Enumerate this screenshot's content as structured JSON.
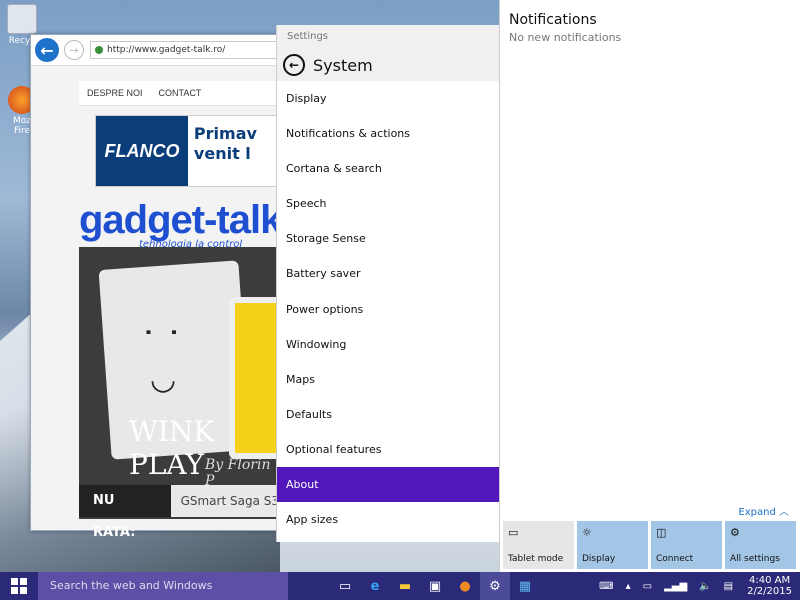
{
  "desktop": {
    "icons": [
      {
        "label": "Recyc",
        "icon": "recycle-bin-icon"
      },
      {
        "label": "Moz Fire",
        "icon": "firefox-icon"
      }
    ]
  },
  "browser": {
    "url": "http://www.gadget-talk.ro/",
    "menu": [
      "DESPRE NOI",
      "CONTACT"
    ],
    "ad": {
      "brand": "FLANCO",
      "text": "Primav venit l"
    },
    "logo": {
      "name": "gadget-talk",
      "tagline": "tehnologia la control"
    },
    "hero": {
      "title": "WINK PLAY",
      "author": "By Florin P"
    },
    "ticker": {
      "label": "NU RATA:",
      "text": "GSmart Saga S3"
    }
  },
  "settings": {
    "window_title": "Settings",
    "page_title": "System",
    "items": [
      "Display",
      "Notifications & actions",
      "Cortana & search",
      "Speech",
      "Storage Sense",
      "Battery saver",
      "Power options",
      "Windowing",
      "Maps",
      "Defaults",
      "Optional features",
      "About",
      "App sizes"
    ],
    "active_index": 11
  },
  "notifications": {
    "title": "Notifications",
    "subtitle": "No new notifications",
    "expand": "Expand",
    "tiles": [
      {
        "label": "Tablet mode",
        "icon": "tablet-icon",
        "on": false
      },
      {
        "label": "Display",
        "icon": "sun-icon",
        "on": true
      },
      {
        "label": "Connect",
        "icon": "connect-icon",
        "on": true
      },
      {
        "label": "All settings",
        "icon": "gear-icon",
        "on": true
      }
    ]
  },
  "taskbar": {
    "search_placeholder": "Search the web and Windows",
    "apps": [
      "task-view-icon",
      "ie-icon",
      "explorer-icon",
      "store-icon",
      "firefox-icon",
      "settings-icon",
      "photos-icon"
    ],
    "time": "4:40 AM",
    "date": "2/2/2015"
  },
  "colors": {
    "accent": "#5117b8",
    "taskbar": "#2a2a78",
    "tile_on": "#a3c6e6"
  }
}
